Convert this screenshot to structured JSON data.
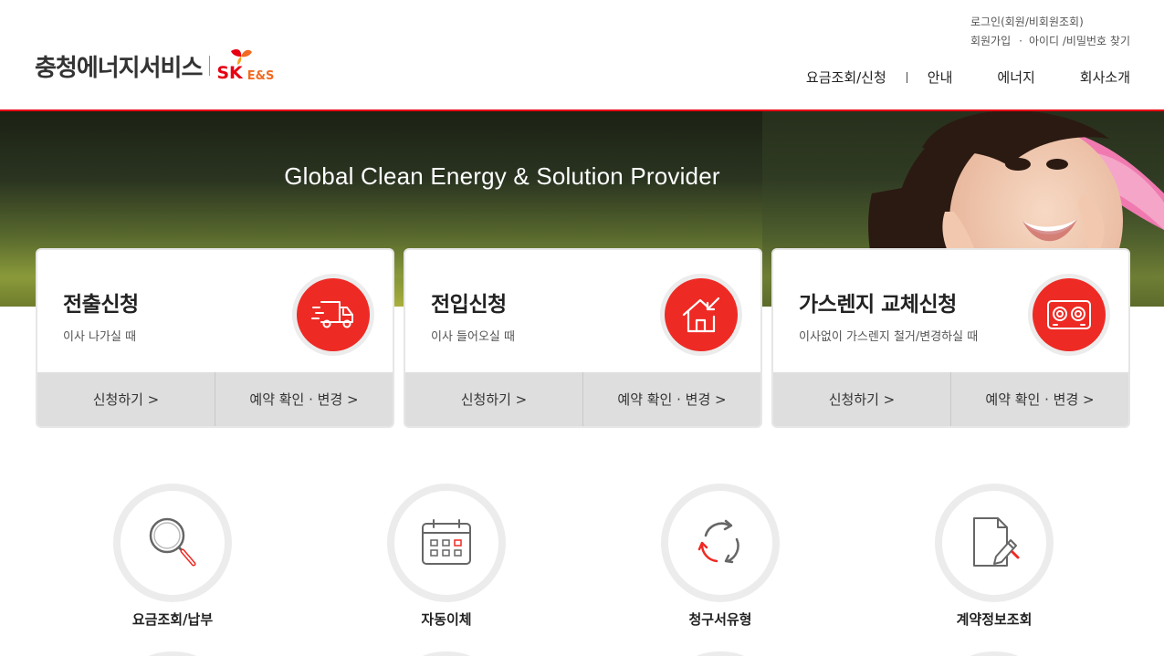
{
  "header": {
    "logo_text": "충청에너지서비스",
    "logo_brand_sk": "SK",
    "logo_brand_es": "E&S",
    "util": {
      "login": "로그인(회원/비회원조회)",
      "signup": "회원가입",
      "dot": "·",
      "find": "아이디 /비밀번호 찾기"
    },
    "nav": [
      "요금조회/신청",
      "안내",
      "에너지",
      "회사소개"
    ]
  },
  "banner": {
    "title": "Global Clean Energy & Solution Provider"
  },
  "cards": [
    {
      "title": "전출신청",
      "subtitle": "이사 나가실 때",
      "icon": "moving-truck-icon",
      "btn_apply": "신청하기 >",
      "btn_check": "예약 확인 · 변경 >"
    },
    {
      "title": "전입신청",
      "subtitle": "이사 들어오실 때",
      "icon": "house-move-in-icon",
      "btn_apply": "신청하기 >",
      "btn_check": "예약 확인 · 변경 >"
    },
    {
      "title": "가스렌지 교체신청",
      "subtitle": "이사없이 가스렌지 철거/변경하실 때",
      "icon": "gas-stove-icon",
      "btn_apply": "신청하기 >",
      "btn_check": "예약 확인 · 변경 >"
    }
  ],
  "quick_menu": [
    {
      "label": "요금조회/납부",
      "icon": "magnifier-icon"
    },
    {
      "label": "자동이체",
      "icon": "calendar-icon"
    },
    {
      "label": "청구서유형",
      "icon": "recycle-arrows-icon"
    },
    {
      "label": "계약정보조회",
      "icon": "document-pen-icon"
    }
  ],
  "colors": {
    "brand_red": "#e60012",
    "icon_red": "#ee2a24",
    "sk_orange": "#f26b21",
    "card_action_bg": "#dedede"
  }
}
